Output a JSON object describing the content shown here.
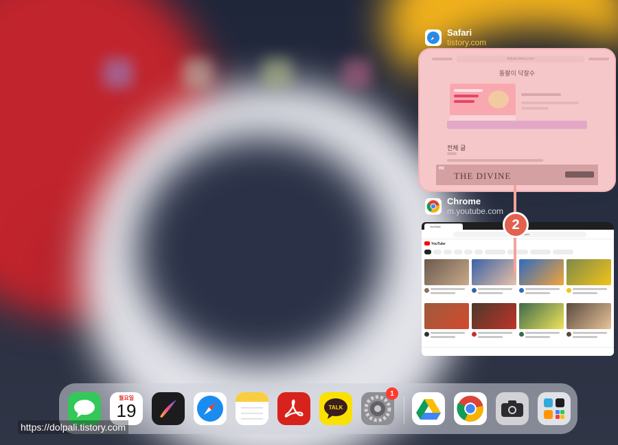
{
  "app_switcher": {
    "apps": [
      {
        "name": "Safari",
        "subtitle": "tistory.com",
        "subtitle_color": "#fbbf4d",
        "preview": {
          "address": "dolpali.tistory.com",
          "blog_title": "돌팔이 닥잘수",
          "section_heading": "전체 글",
          "ad_text": "THE DIVINE"
        }
      },
      {
        "name": "Chrome",
        "subtitle": "m.youtube.com",
        "preview": {
          "tab_label": "YouTube",
          "address": "m.youtube.com",
          "site_label": "YouTube"
        }
      }
    ]
  },
  "annotation": {
    "number": "2",
    "color": "#e3614f"
  },
  "dock": {
    "apps": [
      {
        "id": "messages",
        "icon": "messages-icon"
      },
      {
        "id": "calendar",
        "icon": "calendar-icon",
        "day_label": "월요일",
        "day_number": "19"
      },
      {
        "id": "procreate",
        "icon": "procreate-icon"
      },
      {
        "id": "safari",
        "icon": "safari-icon"
      },
      {
        "id": "notes",
        "icon": "notes-icon"
      },
      {
        "id": "acrobat",
        "icon": "acrobat-icon"
      },
      {
        "id": "kakaotalk",
        "icon": "kakaotalk-icon",
        "label": "TALK"
      },
      {
        "id": "settings",
        "icon": "settings-icon",
        "badge": "1"
      },
      {
        "id": "google-drive",
        "icon": "google-drive-icon"
      },
      {
        "id": "chrome",
        "icon": "chrome-icon"
      },
      {
        "id": "camera",
        "icon": "camera-icon"
      },
      {
        "id": "app-library",
        "icon": "app-library-icon"
      }
    ]
  },
  "watermark": "https://dolpali.tistory.com"
}
